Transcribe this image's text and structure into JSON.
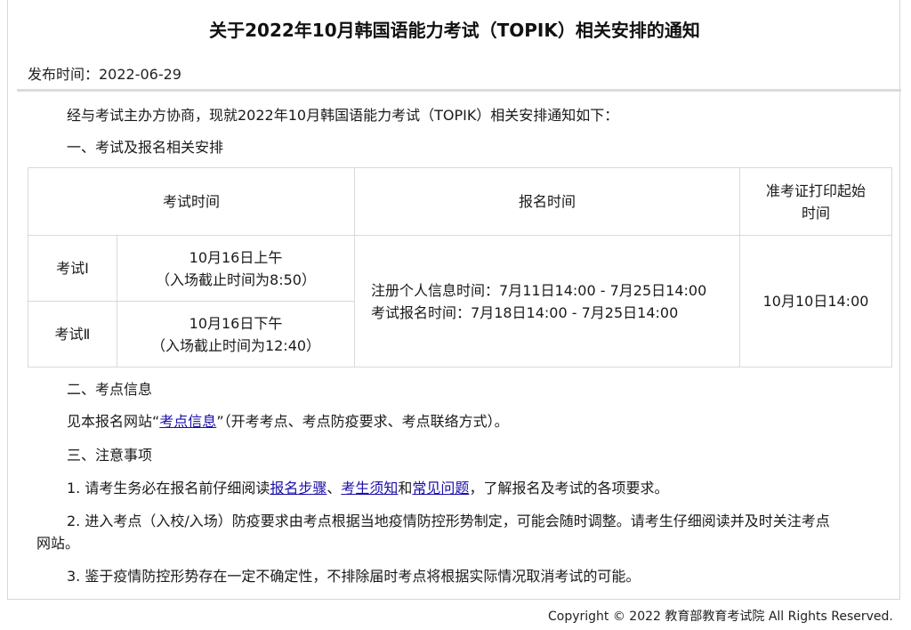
{
  "title": "关于2022年10月韩国语能力考试（TOPIK）相关安排的通知",
  "publish_date": "发布时间：2022-06-29",
  "intro": "经与考试主办方协商，现就2022年10月韩国语能力考试（TOPIK）相关安排通知如下：",
  "section1": "一、考试及报名相关安排",
  "table": {
    "headers": [
      "考试时间",
      "报名时间",
      "准考证打印起始时间"
    ],
    "rows": [
      {
        "name": "考试Ⅰ",
        "time_line1": "10月16日上午",
        "time_line2": "（入场截止时间为8:50）"
      },
      {
        "name": "考试Ⅱ",
        "time_line1": "10月16日下午",
        "time_line2": "（入场截止时间为12:40）"
      }
    ],
    "registration_line1": "注册个人信息时间：7月11日14:00 - 7月25日14:00",
    "registration_line2": "考试报名时间：7月18日14:00 - 7月25日14:00",
    "print_time": "10月10日14:00"
  },
  "section2": "二、考点信息",
  "site_info": {
    "prefix": "见本报名网站“",
    "link": "考点信息",
    "suffix": "”（开考考点、考点防疫要求、考点联络方式）。"
  },
  "section3": "三、注意事项",
  "note1": {
    "prefix": "1. 请考生务必在报名前仔细阅读",
    "link1": "报名步骤",
    "sep1": "、",
    "link2": "考生须知",
    "sep2": "和",
    "link3": "常见问题",
    "suffix": "，了解报名及考试的各项要求。"
  },
  "note2_line1": "2. 进入考点（入校/入场）防疫要求由考点根据当地疫情防控形势制定，可能会随时调整。请考生仔细阅读并及时关注考点",
  "note2_line2": "网站。",
  "note3": "3. 鉴于疫情防控形势存在一定不确定性，不排除届时考点将根据实际情况取消考试的可能。",
  "footer": "Copyright © 2022 教育部教育考试院 All Rights Reserved.",
  "colors": {
    "link": "#1a0dab",
    "rule": "#dcdcdc",
    "border": "#d9d9d9"
  }
}
